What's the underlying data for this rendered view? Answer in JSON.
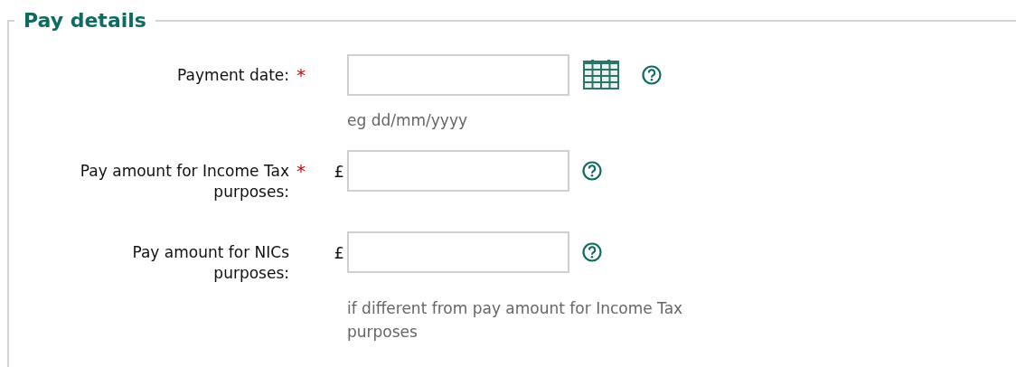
{
  "section": {
    "title": "Pay details"
  },
  "required_marker": "*",
  "fields": [
    {
      "kind": "date",
      "label": "Payment date:",
      "required": true,
      "hint": "eg dd/mm/yyyy"
    },
    {
      "kind": "amount",
      "label": "Pay amount for Income Tax purposes:",
      "required": true,
      "currency": "£"
    },
    {
      "kind": "amount",
      "label": "Pay amount for NICs purposes:",
      "required": false,
      "currency": "£",
      "hint": "if different from pay amount for Income Tax purposes"
    }
  ]
}
